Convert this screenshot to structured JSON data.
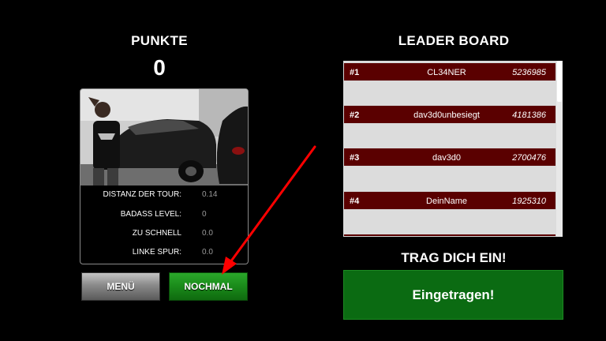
{
  "left": {
    "title": "PUNKTE",
    "score": "0",
    "stats": [
      {
        "label": "DISTANZ DER TOUR:",
        "value": "0.14"
      },
      {
        "label": "BADASS LEVEL:",
        "value": "0"
      },
      {
        "label": "ZU SCHNELL",
        "value": "0.0"
      },
      {
        "label": "LINKE SPUR:",
        "value": "0.0"
      }
    ],
    "buttons": {
      "menu": "MENÜ",
      "again": "NOCHMAL"
    }
  },
  "leaderboard": {
    "title": "LEADER BOARD",
    "entries": [
      {
        "rank": "#1",
        "name": "CL34NER",
        "score": "5236985"
      },
      {
        "rank": "#2",
        "name": "dav3d0unbesiegt",
        "score": "4181386"
      },
      {
        "rank": "#3",
        "name": "dav3d0",
        "score": "2700476"
      },
      {
        "rank": "#4",
        "name": "DeinName",
        "score": "1925310"
      }
    ]
  },
  "signup": {
    "title": "TRAG DICH EIN!",
    "button": "Eingetragen!"
  },
  "colors": {
    "row_bg": "#5a0000",
    "signup_green": "#0b6b12",
    "again_green": "#1a8a1a",
    "arrow_red": "#ff0000"
  },
  "icons": [
    "arrow-annotation"
  ]
}
